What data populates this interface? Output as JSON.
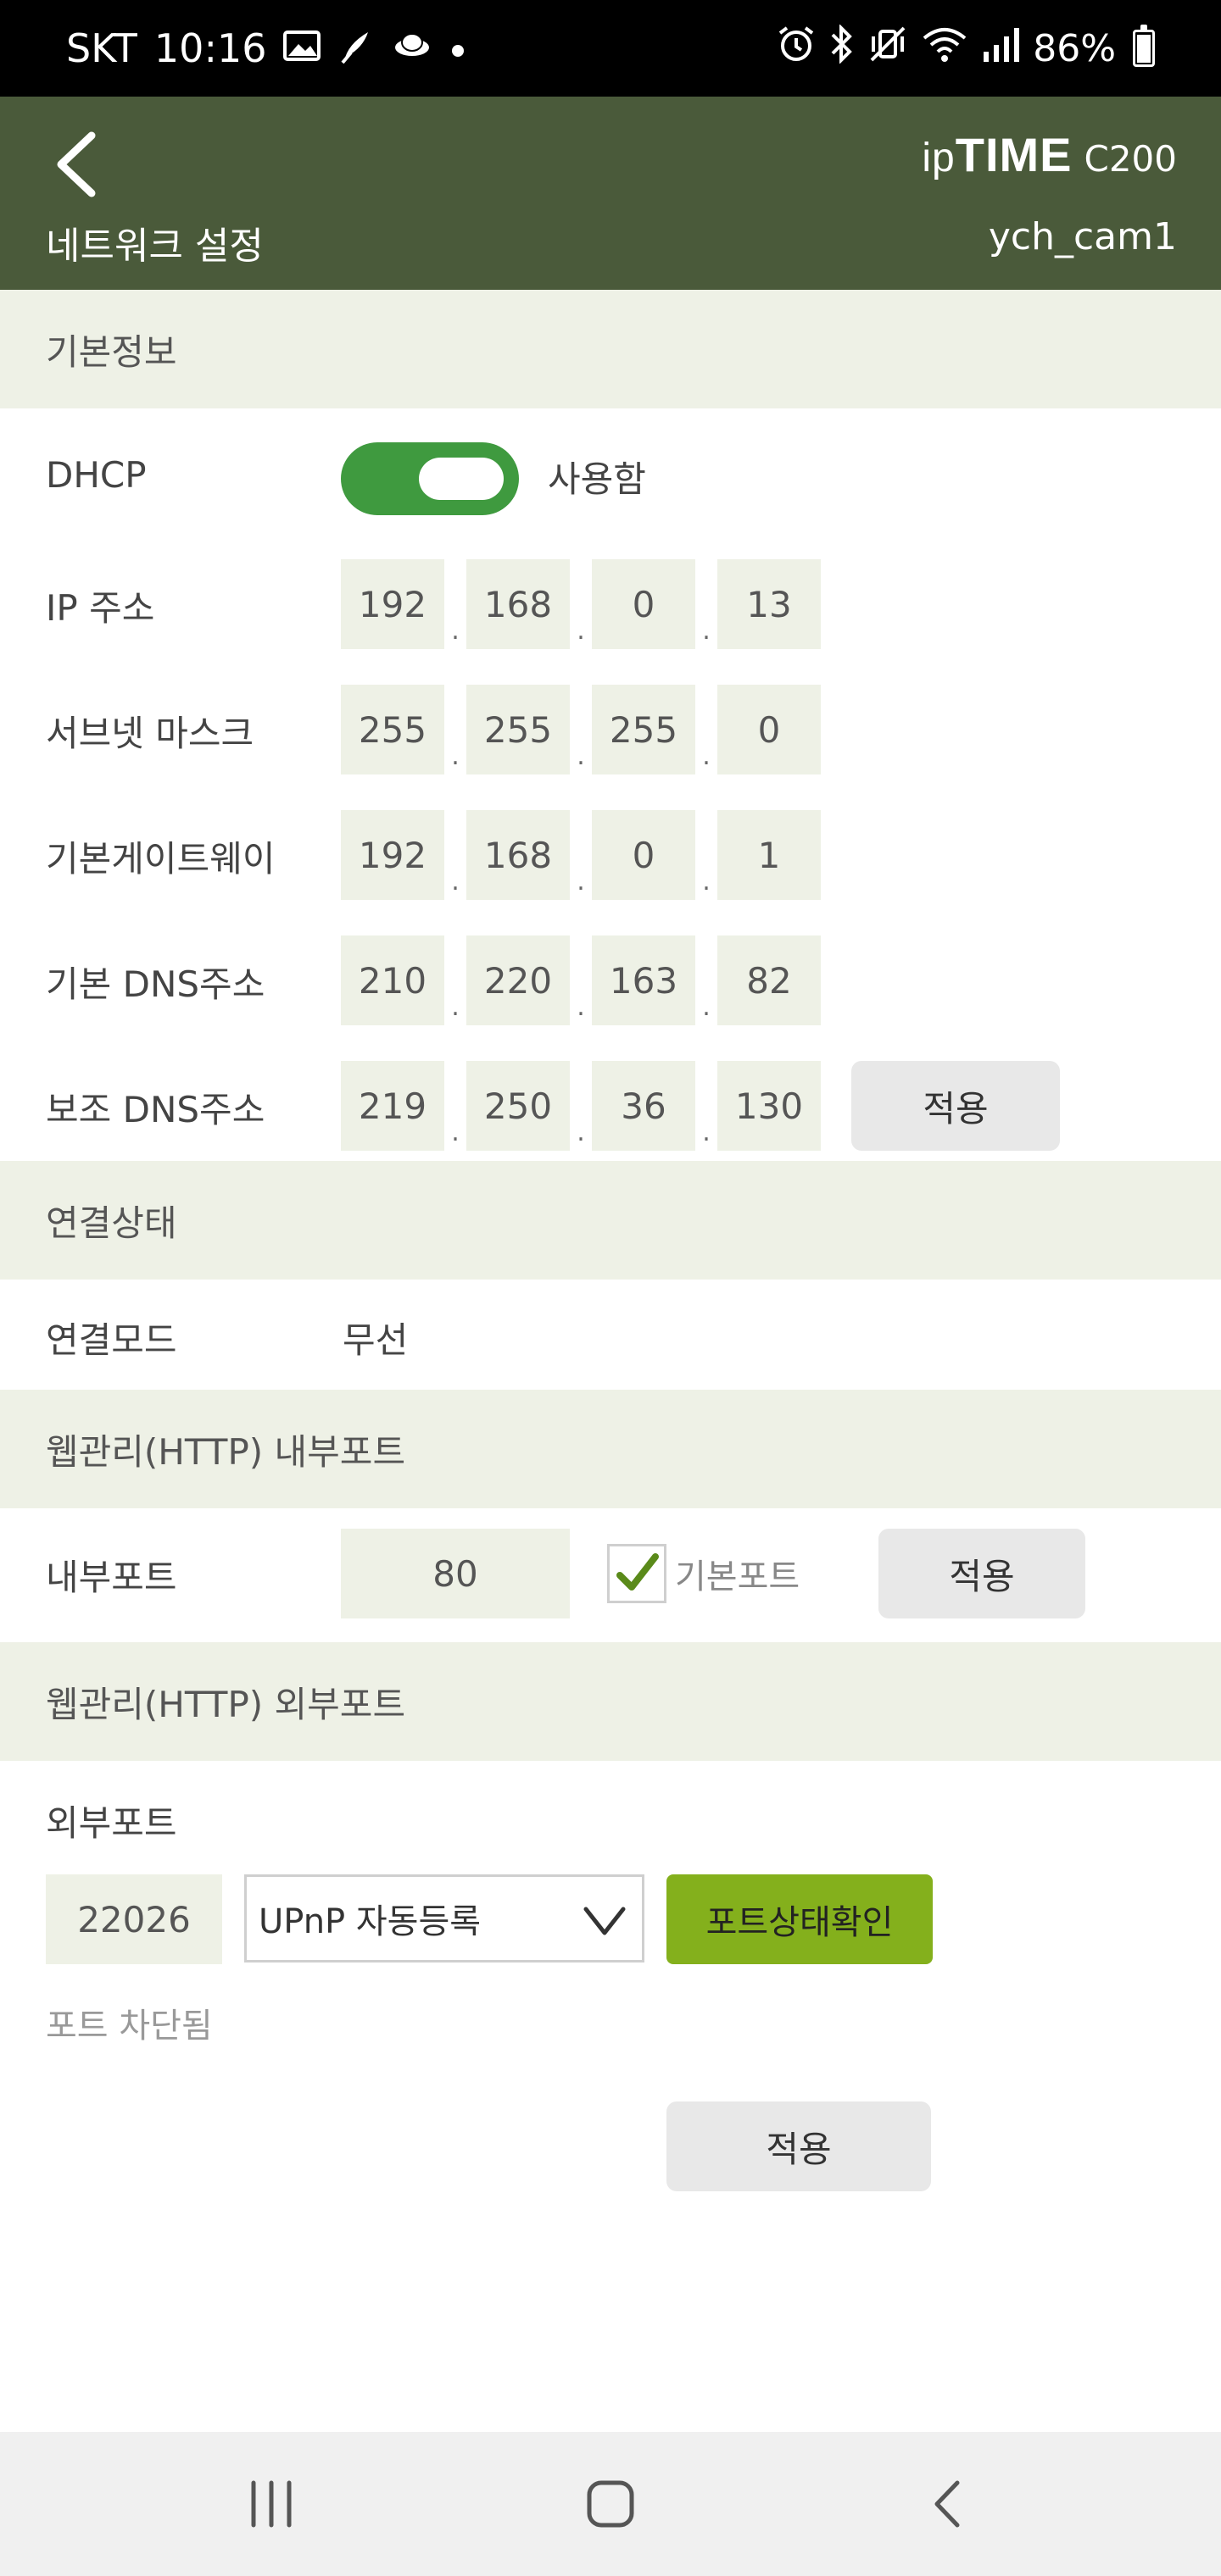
{
  "status_bar": {
    "carrier": "SKT",
    "time": "10:16",
    "battery": "86%",
    "battery_level": 0.86,
    "left_icons": [
      "gallery-icon",
      "feather-icon",
      "planet-icon",
      "dot-icon"
    ],
    "right_icons": [
      "alarm-icon",
      "bluetooth-icon",
      "vibrate-icon",
      "wifi-icon",
      "signal-icon",
      "battery-icon"
    ]
  },
  "header": {
    "brand_lower": "ip",
    "brand_upper": "TIME",
    "model": "C200",
    "page_title": "네트워크 설정",
    "device_name": "ych_cam1"
  },
  "basic_info": {
    "section_title": "기본정보",
    "dhcp": {
      "label": "DHCP",
      "toggle_on": true,
      "toggle_label": "사용함"
    },
    "ip_address": {
      "label": "IP 주소",
      "octets": [
        "192",
        "168",
        "0",
        "13"
      ]
    },
    "subnet_mask": {
      "label": "서브넷 마스크",
      "octets": [
        "255",
        "255",
        "255",
        "0"
      ]
    },
    "gateway": {
      "label": "기본게이트웨이",
      "octets": [
        "192",
        "168",
        "0",
        "1"
      ]
    },
    "primary_dns": {
      "label": "기본 DNS주소",
      "octets": [
        "210",
        "220",
        "163",
        "82"
      ]
    },
    "secondary_dns": {
      "label": "보조 DNS주소",
      "octets": [
        "219",
        "250",
        "36",
        "130"
      ]
    },
    "apply_label": "적용"
  },
  "connection_status": {
    "section_title": "연결상태",
    "mode_label": "연결모드",
    "mode_value": "무선"
  },
  "internal_port": {
    "section_title": "웹관리(HTTP) 내부포트",
    "label": "내부포트",
    "value": "80",
    "default_checked": true,
    "default_label": "기본포트",
    "apply_label": "적용"
  },
  "external_port": {
    "section_title": "웹관리(HTTP) 외부포트",
    "label": "외부포트",
    "value": "22026",
    "mode_selected": "UPnP 자동등록",
    "check_button_label": "포트상태확인",
    "status_text": "포트 차단됨",
    "apply_label": "적용"
  },
  "colors": {
    "header_bg": "#4a5a3a",
    "section_bg": "#eef1e6",
    "toggle_on": "#3f9a3f",
    "accent_button": "#84b01c"
  }
}
